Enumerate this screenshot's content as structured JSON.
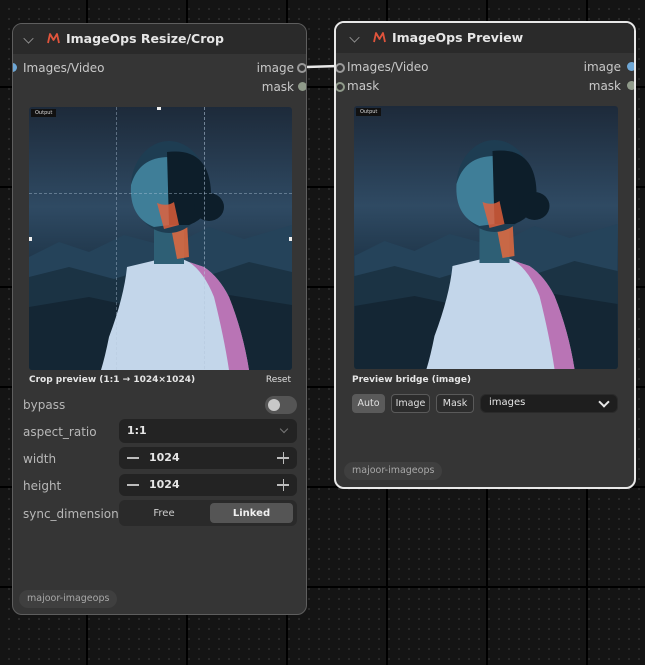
{
  "nodes": {
    "resize": {
      "title": "ImageOps Resize/Crop",
      "input_label": "Images/Video",
      "output_image": "image",
      "output_mask": "mask",
      "output_tag": "Output",
      "crop_preview_label": "Crop preview (1:1 → 1024×1024)",
      "reset_label": "Reset",
      "widgets": {
        "bypass": {
          "label": "bypass",
          "value": false
        },
        "aspect_ratio": {
          "label": "aspect_ratio",
          "value": "1:1"
        },
        "width": {
          "label": "width",
          "value": "1024"
        },
        "height": {
          "label": "height",
          "value": "1024"
        },
        "sync_dimensions": {
          "label": "sync_dimensions",
          "options": [
            "Free",
            "Linked"
          ],
          "selected": "Linked"
        }
      },
      "badge": "majoor-imageops"
    },
    "preview": {
      "title": "ImageOps Preview",
      "input_image": "Images/Video",
      "input_mask": "mask",
      "output_image": "image",
      "output_mask": "mask",
      "output_tag": "Output",
      "bridge_label": "Preview bridge (image)",
      "buttons": [
        "Auto",
        "Image",
        "Mask"
      ],
      "active_button": "Auto",
      "select_value": "images",
      "badge": "majoor-imageops"
    }
  },
  "colors": {
    "slot_image": "#6ea7d6",
    "slot_mask": "#8f9a8a",
    "logo": "#e0543c"
  }
}
